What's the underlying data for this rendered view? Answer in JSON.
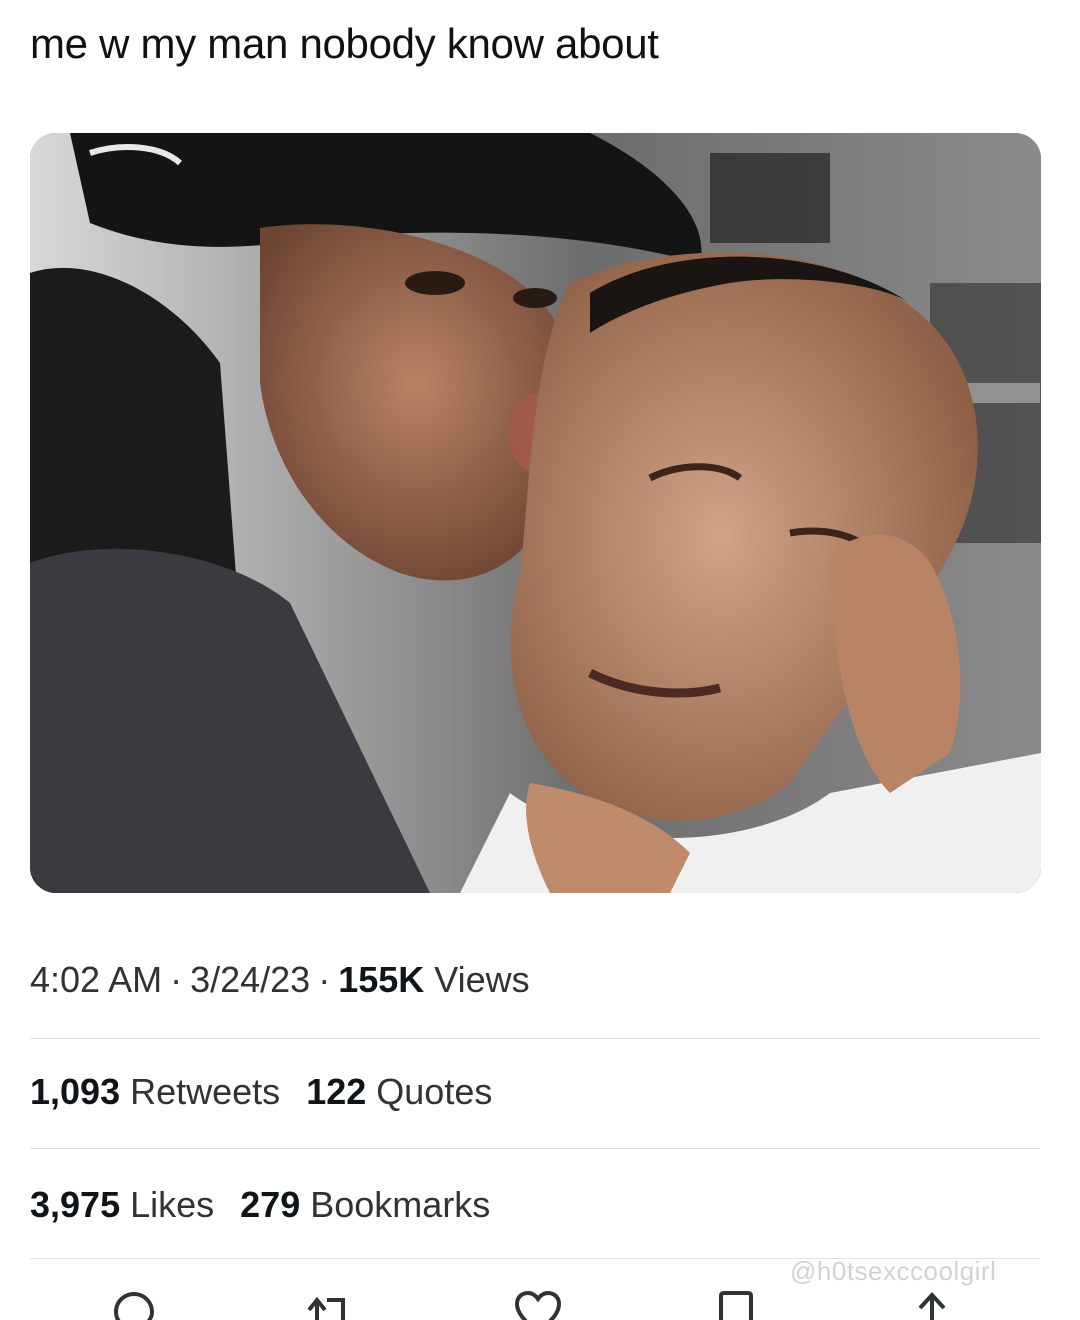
{
  "tweet": {
    "text": "me w my man nobody know about",
    "media_alt": "photo"
  },
  "meta": {
    "time": "4:02 AM",
    "date": "3/24/23",
    "views_count": "155K",
    "views_label": "Views"
  },
  "stats": {
    "retweets_count": "1,093",
    "retweets_label": "Retweets",
    "quotes_count": "122",
    "quotes_label": "Quotes",
    "likes_count": "3,975",
    "likes_label": "Likes",
    "bookmarks_count": "279",
    "bookmarks_label": "Bookmarks"
  },
  "watermark": "@h0tsexccoolgirl",
  "actions": [
    {
      "icon": "reply-icon"
    },
    {
      "icon": "retweet-icon"
    },
    {
      "icon": "like-icon"
    },
    {
      "icon": "bookmark-icon"
    },
    {
      "icon": "share-icon"
    }
  ],
  "colors": {
    "text": "#0f1419",
    "secondary": "#2f3336",
    "divider": "#dde1e4"
  }
}
